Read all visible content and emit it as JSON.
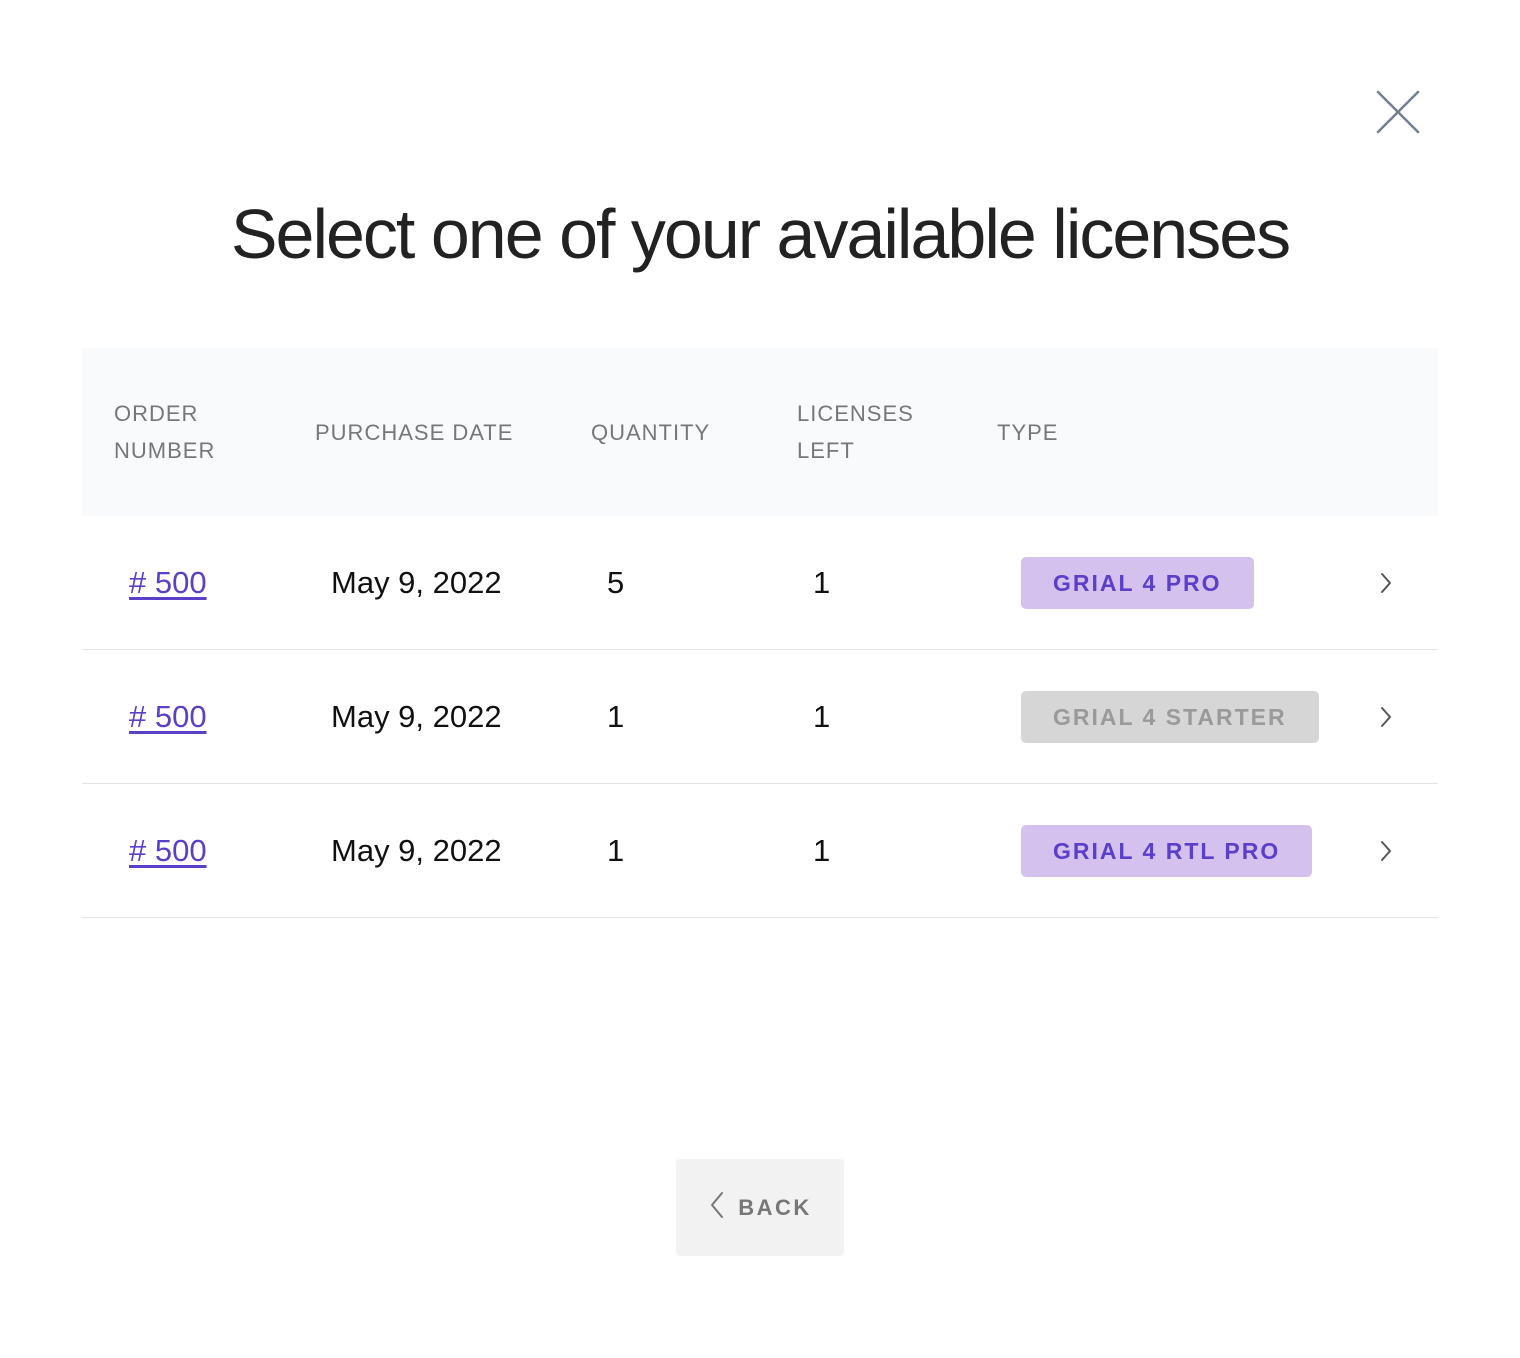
{
  "modal": {
    "title": "Select one of your available licenses",
    "close_icon": "close-icon"
  },
  "table": {
    "headers": {
      "order_number": "ORDER NUMBER",
      "purchase_date": "PURCHASE DATE",
      "quantity": "QUANTITY",
      "licenses_left": "LICENSES LEFT",
      "type": "TYPE"
    },
    "rows": [
      {
        "order_number": "# 500",
        "purchase_date": "May 9, 2022",
        "quantity": "5",
        "licenses_left": "1",
        "type": "GRIAL 4 PRO"
      },
      {
        "order_number": "# 500",
        "purchase_date": "May 9, 2022",
        "quantity": "1",
        "licenses_left": "1",
        "type": "GRIAL 4 STARTER"
      },
      {
        "order_number": "# 500",
        "purchase_date": "May 9, 2022",
        "quantity": "1",
        "licenses_left": "1",
        "type": "GRIAL 4 RTL PRO"
      }
    ],
    "row_icon": "chevron-right-icon"
  },
  "footer": {
    "back_label": "BACK",
    "back_icon": "chevron-left-icon"
  },
  "colors": {
    "link": "#5a3fc9",
    "pro_badge_bg": "#d4c1ee",
    "pro_badge_text": "#5a3fc9",
    "starter_badge_bg": "#d6d6d6",
    "starter_badge_text": "#9a9a9a",
    "header_bg": "#f9fafc"
  }
}
